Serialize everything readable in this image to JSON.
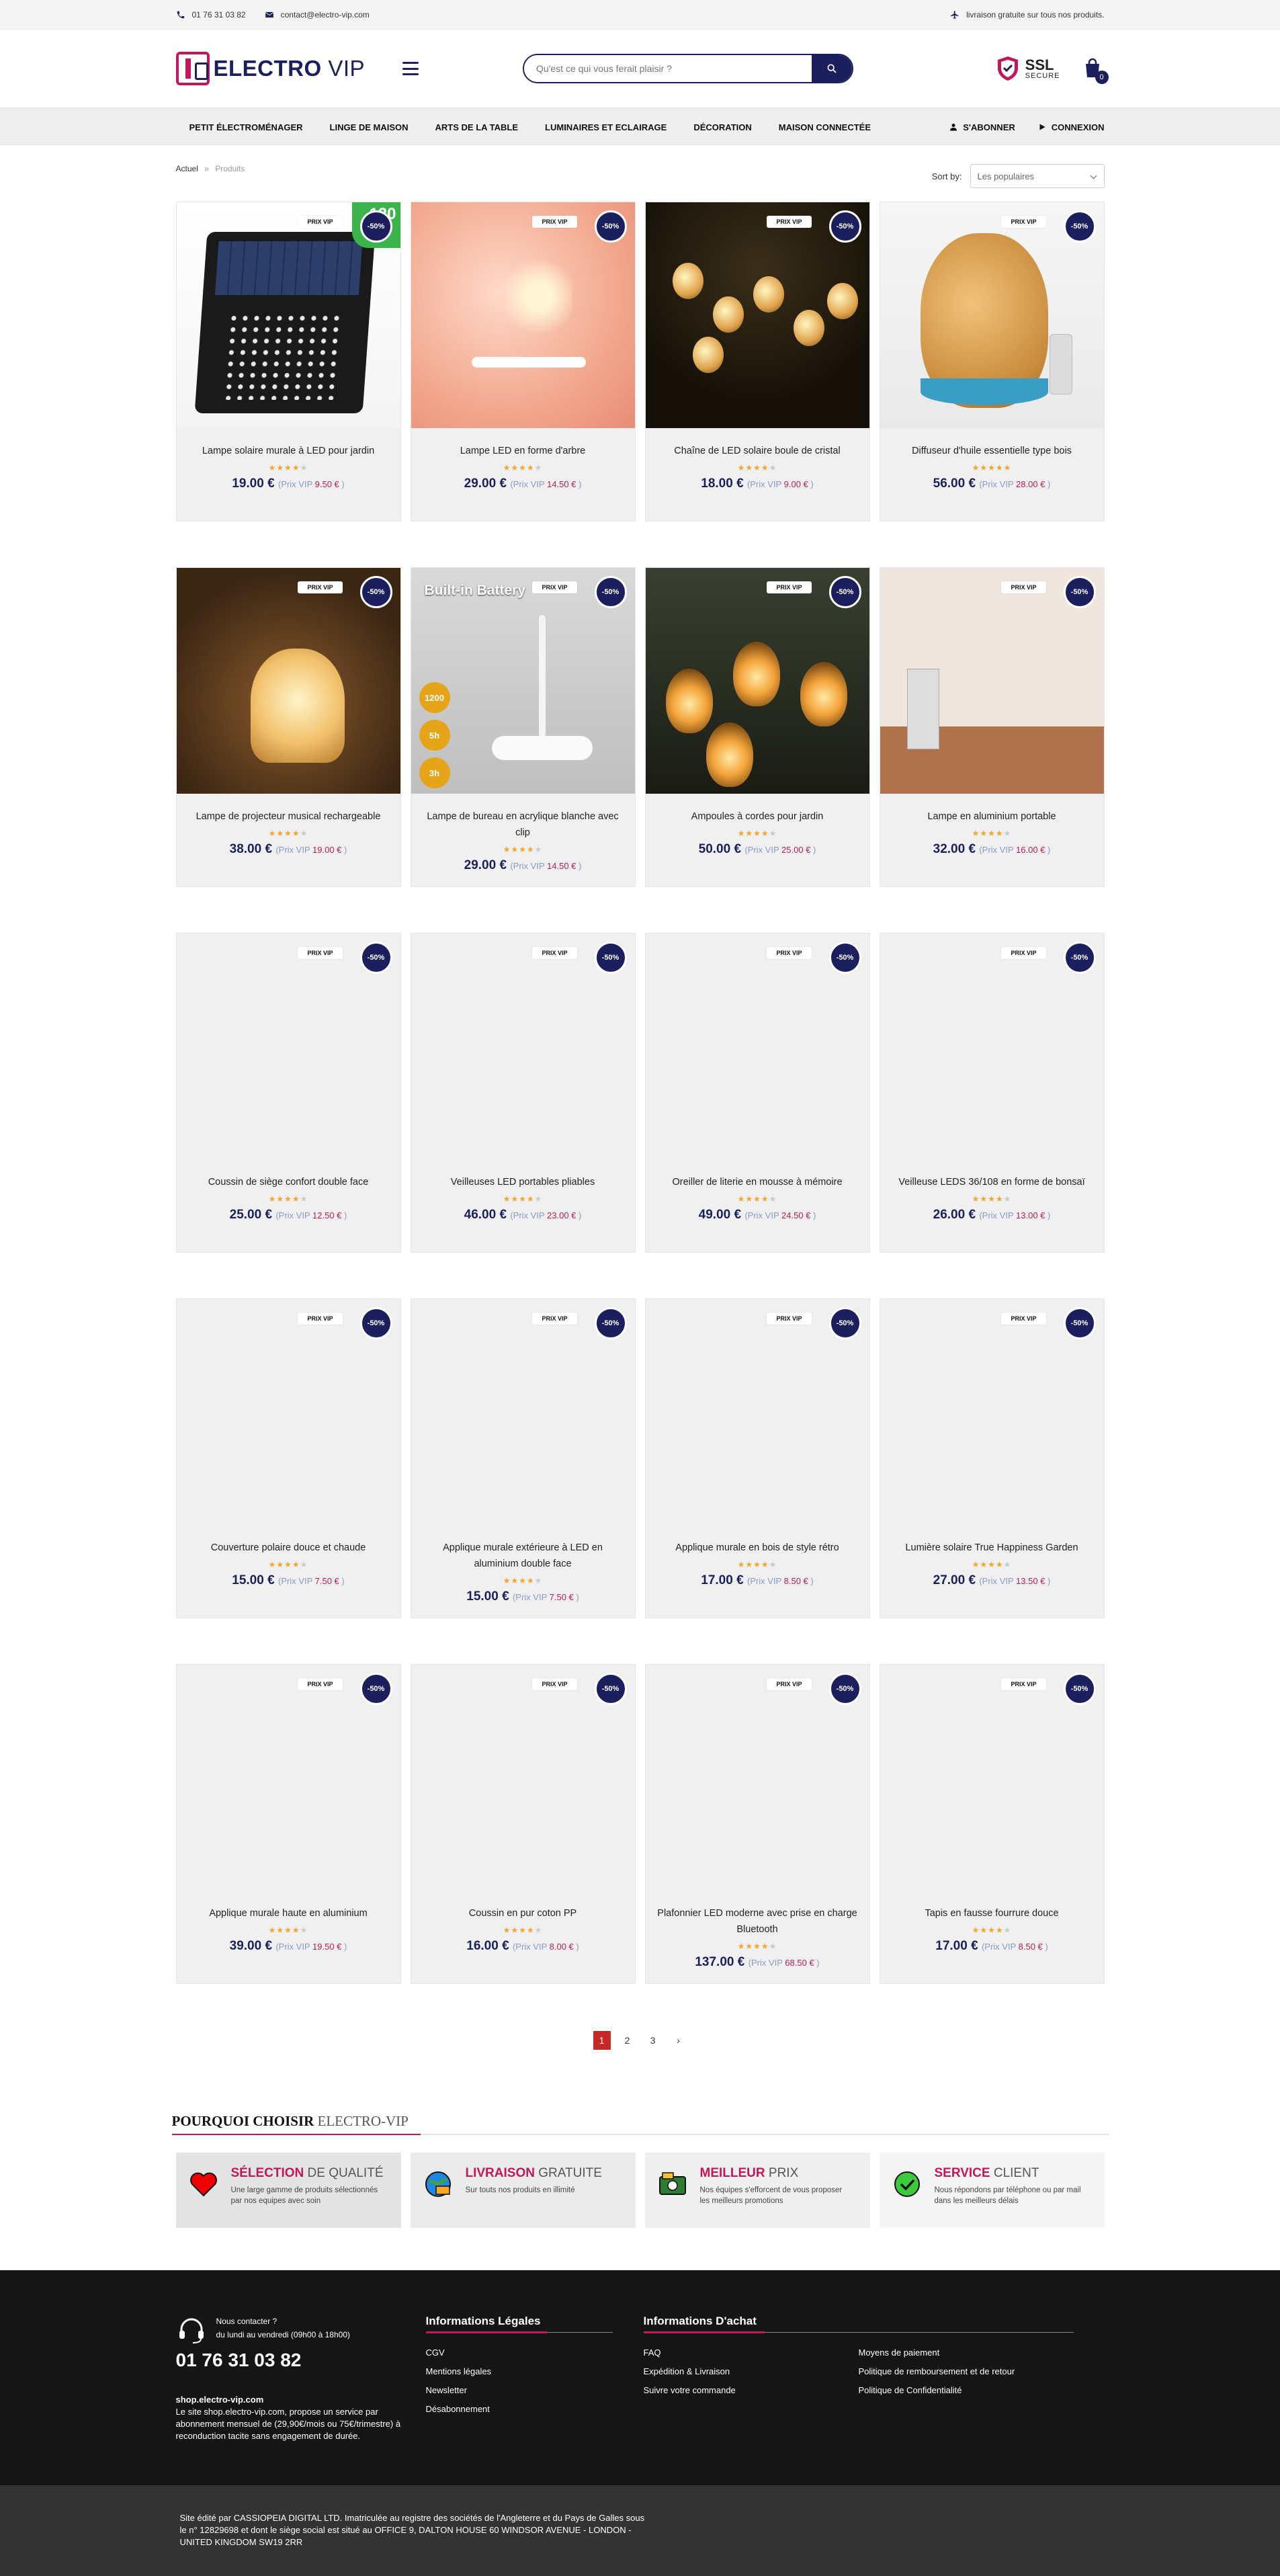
{
  "topbar": {
    "phone": "01 76 31 03 82",
    "email": "contact@electro-vip.com",
    "shipping": "livraison gratuite sur tous nos produits."
  },
  "header": {
    "logo_bold": "ELECTRO",
    "logo_light": "VIP",
    "search_placeholder": "Qu'est ce qui vous ferait plaisir ?",
    "ssl_title": "SSL",
    "ssl_sub": "SECURE",
    "cart_count": "0"
  },
  "nav": {
    "items": [
      "PETIT ÉLECTROMÉNAGER",
      "LINGE DE MAISON",
      "ARTS DE LA TABLE",
      "LUMINAIRES ET ECLAIRAGE",
      "DÉCORATION",
      "MAISON CONNECTÉE"
    ],
    "subscribe": "S'ABONNER",
    "login": "CONNEXION"
  },
  "breadcrumb": {
    "home": "Actuel",
    "sep": "»",
    "current": "Produits"
  },
  "sort": {
    "label": "Sort by:",
    "value": "Les populaires"
  },
  "badges": {
    "vip": "PRIX VIP",
    "off": "-50%"
  },
  "vip_label": "Prix VIP",
  "products": [
    {
      "title": "Lampe solaire murale à LED pour jardin",
      "price": "19.00 €",
      "vip": "9.50 €",
      "rating": 4,
      "image": "solar-lamp"
    },
    {
      "title": "Lampe LED en forme d'arbre",
      "price": "29.00 €",
      "vip": "14.50 €",
      "rating": 4,
      "image": "tree-lamp"
    },
    {
      "title": "Chaîne de LED solaire boule de cristal",
      "price": "18.00 €",
      "vip": "9.00 €",
      "rating": 4,
      "image": "crystal-lights"
    },
    {
      "title": "Diffuseur d'huile essentielle type bois",
      "price": "56.00 €",
      "vip": "28.00 €",
      "rating": 4.5,
      "image": "diffuser"
    },
    {
      "title": "Lampe de projecteur musical rechargeable",
      "price": "38.00 €",
      "vip": "19.00 €",
      "rating": 4,
      "image": "projector-lamp"
    },
    {
      "title": "Lampe de bureau en acrylique blanche avec clip",
      "price": "29.00 €",
      "vip": "14.50 €",
      "rating": 4,
      "image": "desk-lamp"
    },
    {
      "title": "Ampoules à cordes pour jardin",
      "price": "50.00 €",
      "vip": "25.00 €",
      "rating": 4,
      "image": "string-bulbs"
    },
    {
      "title": "Lampe en aluminium portable",
      "price": "32.00 €",
      "vip": "16.00 €",
      "rating": 4,
      "image": "aluminium-lamp"
    },
    {
      "title": "Coussin de siège confort double face",
      "price": "25.00 €",
      "vip": "12.50 €",
      "rating": 4,
      "image": ""
    },
    {
      "title": "Veilleuses LED portables pliables",
      "price": "46.00 €",
      "vip": "23.00 €",
      "rating": 4,
      "image": ""
    },
    {
      "title": "Oreiller de literie en mousse à mémoire",
      "price": "49.00 €",
      "vip": "24.50 €",
      "rating": 4,
      "image": ""
    },
    {
      "title": "Veilleuse LEDS 36/108 en forme de bonsaï",
      "price": "26.00 €",
      "vip": "13.00 €",
      "rating": 4,
      "image": ""
    },
    {
      "title": "Couverture polaire douce et chaude",
      "price": "15.00 €",
      "vip": "7.50 €",
      "rating": 4,
      "image": ""
    },
    {
      "title": "Applique murale extérieure à LED en aluminium double face",
      "price": "15.00 €",
      "vip": "7.50 €",
      "rating": 4,
      "image": ""
    },
    {
      "title": "Applique murale en bois de style rétro",
      "price": "17.00 €",
      "vip": "8.50 €",
      "rating": 4,
      "image": ""
    },
    {
      "title": "Lumière solaire True Happiness Garden",
      "price": "27.00 €",
      "vip": "13.50 €",
      "rating": 4,
      "image": ""
    },
    {
      "title": "Applique murale haute en aluminium",
      "price": "39.00 €",
      "vip": "19.50 €",
      "rating": 4,
      "image": ""
    },
    {
      "title": "Coussin en pur coton PP",
      "price": "16.00 €",
      "vip": "8.00 €",
      "rating": 4,
      "image": ""
    },
    {
      "title": "Plafonnier LED moderne avec prise en charge Bluetooth",
      "price": "137.00 €",
      "vip": "68.50 €",
      "rating": 4,
      "image": ""
    },
    {
      "title": "Tapis en fausse fourrure douce",
      "price": "17.00 €",
      "vip": "8.50 €",
      "rating": 4,
      "image": ""
    }
  ],
  "solar_tag": "120",
  "desk_lamp": {
    "header": "Built-in Battery",
    "c1": "1200",
    "c2": "5h",
    "c3": "3h"
  },
  "pagination": {
    "pages": [
      "1",
      "2",
      "3"
    ],
    "active": "1",
    "next": "›"
  },
  "why": {
    "title_bold": "POURQUOI CHOISIR",
    "title_light": "ELECTRO-VIP",
    "cards": [
      {
        "hl": "SÉLECTION",
        "rest": "DE QUALITÉ",
        "text": "Une large gamme de produits sélectionnés par nos equipes avec soin",
        "icon": "heart-icon"
      },
      {
        "hl": "LIVRAISON",
        "rest": "GRATUITE",
        "text": "Sur touts nos produits en illimité",
        "icon": "globe-delivery-icon"
      },
      {
        "hl": "MEILLEUR",
        "rest": "PRIX",
        "text": "Nos équipes s'efforcent de vous proposer les meilleurs promotions",
        "icon": "money-icon"
      },
      {
        "hl": "SERVICE",
        "rest": "CLIENT",
        "text": "Nous répondons par téléphone ou par mail dans les meilleurs délais",
        "icon": "check-icon"
      }
    ]
  },
  "footer": {
    "contact_line1": "Nous contacter ?",
    "contact_line2": "du lundi au vendredi (09h00 à 18h00)",
    "phone": "01 76 31 03 82",
    "site_title": "shop.electro-vip.com",
    "site_text": "Le site shop.electro-vip.com, propose un service par abonnement mensuel de (29,90€/mois ou 75€/trimestre) à reconduction tacite sans engagement de durée.",
    "legal_title": "Informations Légales",
    "legal_links": [
      "CGV",
      "Mentions légales",
      "Newsletter",
      "Désabonnement"
    ],
    "buy_title": "Informations D'achat",
    "buy_links_left": [
      "FAQ",
      "Expédition & Livraison",
      "Suivre votre commande"
    ],
    "buy_links_right": [
      "Moyens de paiement",
      "Politique de remboursement et de retour",
      "Politique de Confidentialité"
    ],
    "legal_text": "Site édité par CASSIOPEIA DIGITAL LTD. Imatriculée au registre des sociétés de l'Angleterre et du Pays de Galles sous le n° 12829698 et dont le siège social est situé au OFFICE 9, DALTON HOUSE 60 WINDSOR AVENUE - LONDON - UNITED KINGDOM SW19 2RR"
  },
  "colors": {
    "navy": "#1b1f5e",
    "magenta": "#c2185b",
    "star": "#f5a623",
    "footer": "#151515"
  }
}
